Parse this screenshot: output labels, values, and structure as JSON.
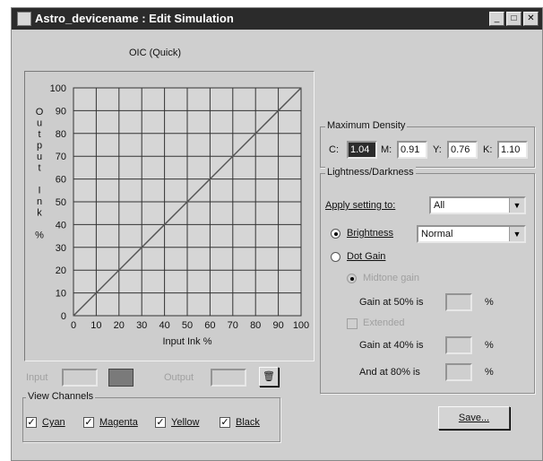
{
  "window": {
    "title": "Astro_devicename : Edit Simulation"
  },
  "chart": {
    "title": "OIC (Quick)"
  },
  "chart_data": {
    "type": "line",
    "title": "OIC (Quick)",
    "xlabel": "Input Ink %",
    "ylabel": "Output Ink %",
    "xlim": [
      0,
      100
    ],
    "ylim": [
      0,
      100
    ],
    "x_ticks": [
      "0",
      "10",
      "20",
      "30",
      "40",
      "50",
      "60",
      "70",
      "80",
      "90",
      "100"
    ],
    "y_ticks": [
      "0",
      "10",
      "20",
      "30",
      "40",
      "50",
      "60",
      "70",
      "80",
      "90",
      "100"
    ],
    "grid": true,
    "series": [
      {
        "x": [
          0,
          100
        ],
        "y": [
          0,
          100
        ]
      }
    ]
  },
  "below_chart": {
    "input_label": "Input",
    "input_value": "",
    "output_label": "Output",
    "output_value": ""
  },
  "view_channels": {
    "title": "View Channels",
    "items": [
      {
        "label": "Cyan",
        "checked": true
      },
      {
        "label": "Magenta",
        "checked": true
      },
      {
        "label": "Yellow",
        "checked": true
      },
      {
        "label": "Black",
        "checked": true
      }
    ]
  },
  "max_density": {
    "title": "Maximum Density",
    "c_label": "C:",
    "c_value": "1.04",
    "m_label": "M:",
    "m_value": "0.91",
    "y_label": "Y:",
    "y_value": "0.76",
    "k_label": "K:",
    "k_value": "1.10"
  },
  "lightness": {
    "title": "Lightness/Darkness",
    "apply_label": "Apply setting to:",
    "apply_value": "All",
    "brightness_label": "Brightness",
    "brightness_value": "Normal",
    "dotgain_label": "Dot Gain",
    "midtone_label": "Midtone gain",
    "gain50_label": "Gain at 50% is",
    "gain50_value": "",
    "extended_label": "Extended",
    "gain40_label": "Gain at 40% is",
    "gain40_value": "",
    "gain80_label": "And at 80% is",
    "gain80_value": "",
    "pct": "%"
  },
  "buttons": {
    "save": "Save..."
  }
}
